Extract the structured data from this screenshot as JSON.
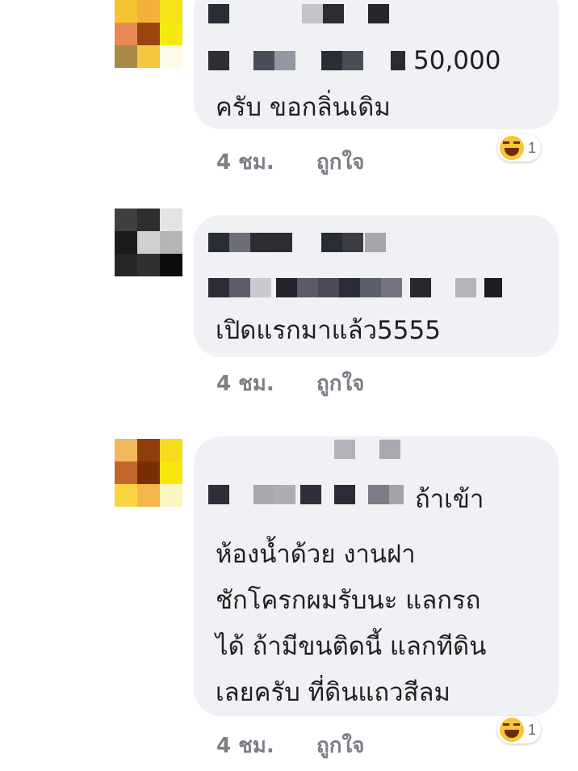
{
  "comments": [
    {
      "lines": [
        "50,000",
        "ครับ ขอกลิ่นเดิม"
      ],
      "time": "4 ชม.",
      "like": "ถูกใจ",
      "reaction": {
        "icon": "laughing-emoji-icon",
        "count": "1"
      }
    },
    {
      "lines": [
        "เปิดแรกมาแล้ว5555"
      ],
      "time": "4 ชม.",
      "like": "ถูกใจ"
    },
    {
      "lines": [
        "ถ้าเข้า",
        "ห้องน้ำด้วย งานฝา",
        "ชักโครกผมรับนะ แลกรถ",
        "ได้ ถ้ามีขนติดนี้ แลกทีดิน",
        "เลยครับ ที่ดินแถวสีลม"
      ],
      "time": "4 ชม.",
      "like": "ถูกใจ",
      "reaction": {
        "icon": "laughing-emoji-icon",
        "count": "1"
      }
    }
  ],
  "colors": {
    "bubble": "#eff1f4",
    "meta_text": "#7b7f86",
    "reaction_emoji": "#f7c634"
  }
}
